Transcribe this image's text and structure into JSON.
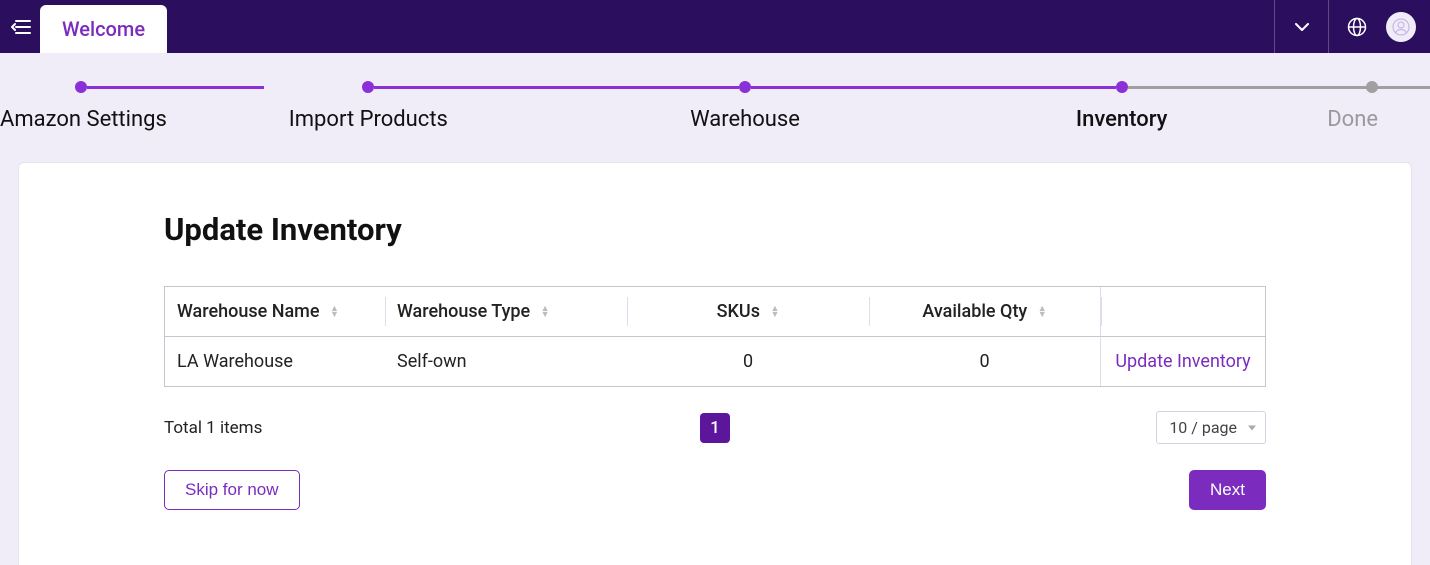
{
  "topbar": {
    "tab_label": "Welcome"
  },
  "stepper": {
    "steps": [
      {
        "label": "Amazon Settings",
        "state": "done"
      },
      {
        "label": "Import Products",
        "state": "done"
      },
      {
        "label": "Warehouse",
        "state": "done"
      },
      {
        "label": "Inventory",
        "state": "active"
      },
      {
        "label": "Done",
        "state": "future"
      }
    ]
  },
  "card": {
    "title": "Update Inventory"
  },
  "table": {
    "headers": {
      "warehouse_name": "Warehouse Name",
      "warehouse_type": "Warehouse Type",
      "skus": "SKUs",
      "available_qty": "Available Qty",
      "action": ""
    },
    "rows": [
      {
        "warehouse_name": "LA Warehouse",
        "warehouse_type": "Self-own",
        "skus": "0",
        "available_qty": "0",
        "action": "Update Inventory"
      }
    ]
  },
  "pagination": {
    "total_text": "Total 1 items",
    "page": "1",
    "page_size_label": "10 / page"
  },
  "buttons": {
    "skip": "Skip for now",
    "next": "Next"
  }
}
